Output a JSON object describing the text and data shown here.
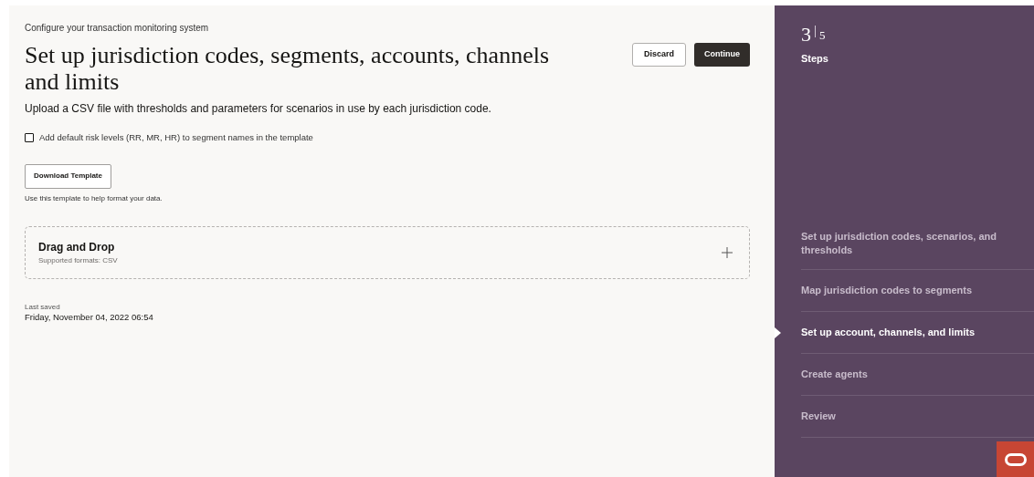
{
  "eyebrow": "Configure your transaction monitoring system",
  "title": "Set up jurisdiction codes, segments, accounts, channels and limits",
  "description": "Upload a CSV file with thresholds and parameters for scenarios in use by each jurisdiction code.",
  "buttons": [
    {
      "label": "Discard",
      "kind": "secondary"
    },
    {
      "label": "Continue",
      "kind": "primary"
    }
  ],
  "checkbox": {
    "label": "Add default risk levels (RR, MR, HR) to segment names in the template",
    "checked": false
  },
  "download": {
    "label": "Download Template",
    "help": "Use this template to help format your data."
  },
  "dropzone": {
    "title": "Drag and Drop",
    "subtitle": "Supported formats: CSV"
  },
  "last_saved": {
    "label": "Last saved",
    "value": "Friday, November 04, 2022 06:54"
  },
  "steps": {
    "current": "3",
    "total": "5",
    "label": "Steps",
    "items": [
      {
        "label": "Set up jurisdiction codes, scenarios, and thresholds",
        "selected": false
      },
      {
        "label": "Map jurisdiction codes to segments",
        "selected": false
      },
      {
        "label": "Set up account, channels, and limits",
        "selected": true
      },
      {
        "label": "Create agents",
        "selected": false
      },
      {
        "label": "Review",
        "selected": false
      }
    ]
  }
}
